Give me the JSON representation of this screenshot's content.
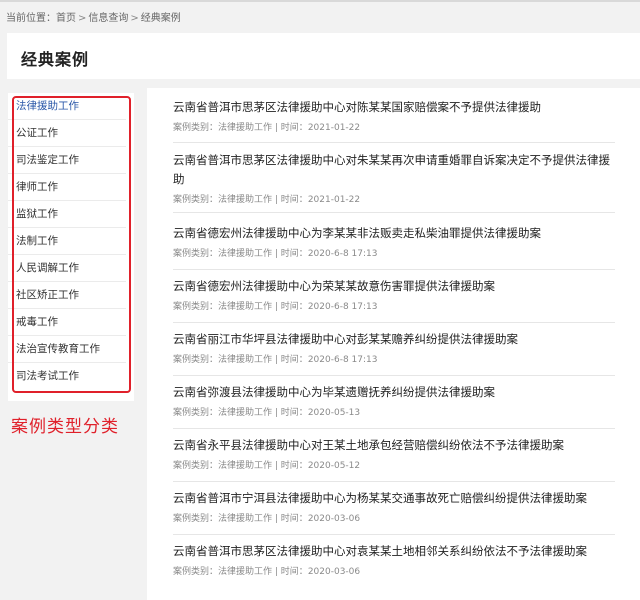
{
  "breadcrumb": {
    "prefix": "当前位置：",
    "items": [
      "首页",
      "信息查询",
      "经典案例"
    ],
    "separator": ">"
  },
  "page_title": "经典案例",
  "sidebar": {
    "items": [
      {
        "label": "法律援助工作",
        "active": true
      },
      {
        "label": "公证工作"
      },
      {
        "label": "司法鉴定工作"
      },
      {
        "label": "律师工作"
      },
      {
        "label": "监狱工作"
      },
      {
        "label": "法制工作"
      },
      {
        "label": "人民调解工作"
      },
      {
        "label": "社区矫正工作"
      },
      {
        "label": "戒毒工作"
      },
      {
        "label": "法治宣传教育工作"
      },
      {
        "label": "司法考试工作"
      }
    ]
  },
  "annotation": "案例类型分类",
  "colors": {
    "accent": "#2a57a8",
    "annotation": "#e0202a"
  },
  "cases": [
    {
      "title": "云南省普洱市思茅区法律援助中心对陈某某国家赔偿案不予提供法律援助",
      "category_label": "案例类别：",
      "category": "法律援助工作",
      "time_label": "时间：",
      "time": "2021-01-22"
    },
    {
      "title": "云南省普洱市思茅区法律援助中心对朱某某再次申请重婚罪自诉案决定不予提供法律援助",
      "category_label": "案例类别：",
      "category": "法律援助工作",
      "time_label": "时间：",
      "time": "2021-01-22"
    },
    {
      "title": "云南省德宏州法律援助中心为李某某非法贩卖走私柴油罪提供法律援助案",
      "category_label": "案例类别：",
      "category": "法律援助工作",
      "time_label": "时间：",
      "time": "2020-6-8 17:13"
    },
    {
      "title": "云南省德宏州法律援助中心为荣某某故意伤害罪提供法律援助案",
      "category_label": "案例类别：",
      "category": "法律援助工作",
      "time_label": "时间：",
      "time": "2020-6-8 17:13"
    },
    {
      "title": "云南省丽江市华坪县法律援助中心对彭某某赡养纠纷提供法律援助案",
      "category_label": "案例类别：",
      "category": "法律援助工作",
      "time_label": "时间：",
      "time": "2020-6-8 17:13"
    },
    {
      "title": "云南省弥渡县法律援助中心为毕某遗赠抚养纠纷提供法律援助案",
      "category_label": "案例类别：",
      "category": "法律援助工作",
      "time_label": "时间：",
      "time": "2020-05-13"
    },
    {
      "title": "云南省永平县法律援助中心对王某土地承包经营赔偿纠纷依法不予法律援助案",
      "category_label": "案例类别：",
      "category": "法律援助工作",
      "time_label": "时间：",
      "time": "2020-05-12"
    },
    {
      "title": "云南省普洱市宁洱县法律援助中心为杨某某交通事故死亡赔偿纠纷提供法律援助案",
      "category_label": "案例类别：",
      "category": "法律援助工作",
      "time_label": "时间：",
      "time": "2020-03-06"
    },
    {
      "title": "云南省普洱市思茅区法律援助中心对袁某某土地相邻关系纠纷依法不予法律援助案",
      "category_label": "案例类别：",
      "category": "法律援助工作",
      "time_label": "时间：",
      "time": "2020-03-06"
    }
  ]
}
